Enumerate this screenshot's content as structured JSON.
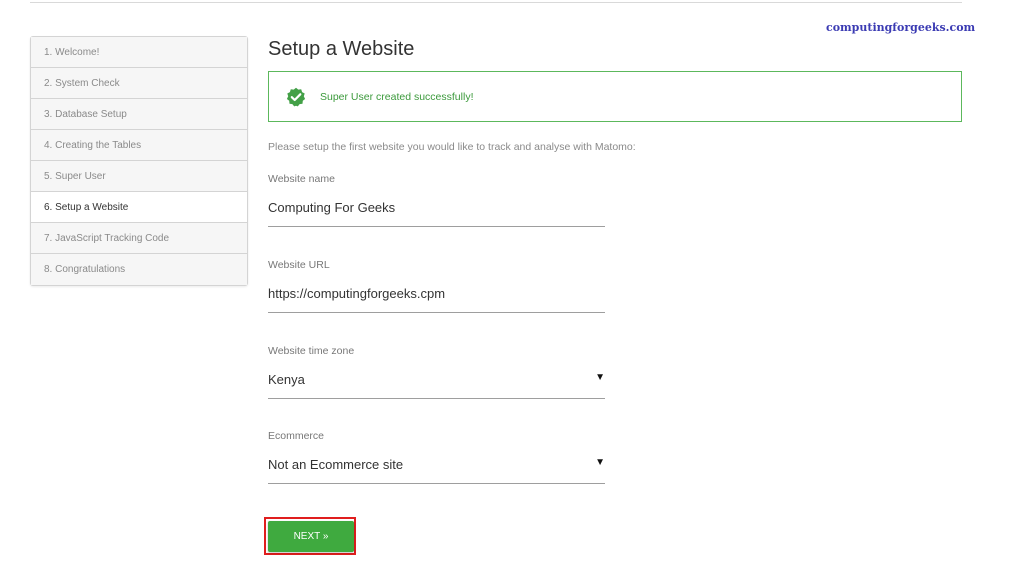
{
  "watermark": "computingforgeeks.com",
  "steps": [
    {
      "label": "1. Welcome!",
      "active": false
    },
    {
      "label": "2. System Check",
      "active": false
    },
    {
      "label": "3. Database Setup",
      "active": false
    },
    {
      "label": "4. Creating the Tables",
      "active": false
    },
    {
      "label": "5. Super User",
      "active": false
    },
    {
      "label": "6. Setup a Website",
      "active": true
    },
    {
      "label": "7. JavaScript Tracking Code",
      "active": false
    },
    {
      "label": "8. Congratulations",
      "active": false
    }
  ],
  "page_title": "Setup a Website",
  "alert": {
    "message": "Super User created successfully!",
    "icon": "check-badge-icon",
    "color": "#5cb85c"
  },
  "intro": "Please setup the first website you would like to track and analyse with Matomo:",
  "form": {
    "website_name": {
      "label": "Website name",
      "value": "Computing For Geeks"
    },
    "website_url": {
      "label": "Website URL",
      "value": "https://computingforgeeks.cpm"
    },
    "timezone": {
      "label": "Website time zone",
      "value": "Kenya",
      "icon": "caret-down-icon"
    },
    "ecommerce": {
      "label": "Ecommerce",
      "value": "Not an Ecommerce site",
      "icon": "caret-down-icon"
    }
  },
  "next_button": {
    "label": "NEXT »",
    "color": "#3faa3f",
    "highlight_color": "#e01e1e"
  }
}
